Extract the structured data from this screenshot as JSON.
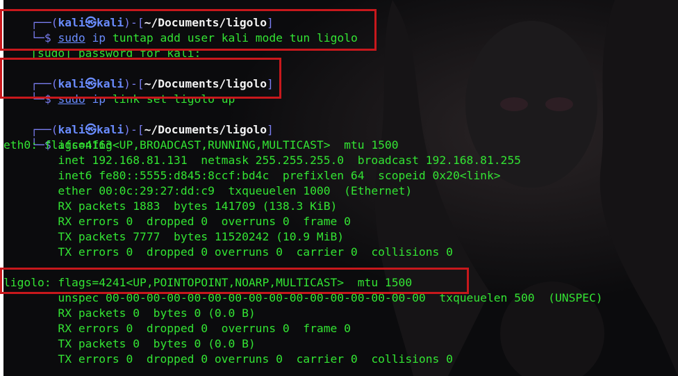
{
  "colors": {
    "background": "#0b0b0d",
    "prompt_frame": "#7a7ef2",
    "prompt_user": "#6a8cff",
    "path": "#f2f2f2",
    "output": "#33e433",
    "highlight": "#c8181c"
  },
  "prompt": {
    "top_left": "┌──(",
    "user": "kali",
    "at_icon": "㉿",
    "host": "kali",
    "sep": ")-[",
    "path": "~/Documents/ligolo",
    "close": "]",
    "bottom_left": "└─$"
  },
  "block1": {
    "sudo": "sudo",
    "cmd": "ip",
    "args": "tuntap add user kali mode tun ligolo",
    "password_prompt": "[sudo] password for kali:"
  },
  "block2": {
    "sudo": "sudo",
    "cmd": "ip",
    "args": "link set ligolo up"
  },
  "block3": {
    "cmd": "ifconfig"
  },
  "eth0": {
    "header": "eth0: flags=4163<UP,BROADCAST,RUNNING,MULTICAST>  mtu 1500",
    "lines": [
      "        inet 192.168.81.131  netmask 255.255.255.0  broadcast 192.168.81.255",
      "        inet6 fe80::5555:d845:8ccf:bd4c  prefixlen 64  scopeid 0x20<link>",
      "        ether 00:0c:29:27:dd:c9  txqueuelen 1000  (Ethernet)",
      "        RX packets 1883  bytes 141709 (138.3 KiB)",
      "        RX errors 0  dropped 0  overruns 0  frame 0",
      "        TX packets 7777  bytes 11520242 (10.9 MiB)",
      "        TX errors 0  dropped 0 overruns 0  carrier 0  collisions 0"
    ]
  },
  "ligolo": {
    "header": "ligolo: flags=4241<UP,POINTOPOINT,NOARP,MULTICAST>  mtu 1500",
    "lines": [
      "        unspec 00-00-00-00-00-00-00-00-00-00-00-00-00-00-00-00  txqueuelen 500  (UNSPEC)",
      "        RX packets 0  bytes 0 (0.0 B)",
      "        RX errors 0  dropped 0  overruns 0  frame 0",
      "        TX packets 0  bytes 0 (0.0 B)",
      "        TX errors 0  dropped 0 overruns 0  carrier 0  collisions 0"
    ]
  }
}
